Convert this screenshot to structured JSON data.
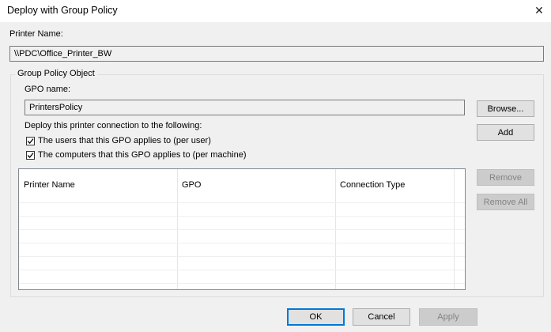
{
  "window": {
    "title": "Deploy with Group Policy",
    "close_glyph": "✕"
  },
  "printer": {
    "label": "Printer Name:",
    "value": "\\\\PDC\\Office_Printer_BW"
  },
  "group": {
    "title": "Group Policy Object",
    "gpo_label": "GPO name:",
    "gpo_value": "PrintersPolicy",
    "deploy_label": "Deploy this printer connection to the following:",
    "options": [
      {
        "label": "The users that this GPO applies to (per user)",
        "checked": true
      },
      {
        "label": "The computers that this GPO applies to (per machine)",
        "checked": true
      }
    ],
    "buttons": {
      "browse": "Browse...",
      "add": "Add",
      "remove": "Remove",
      "remove_all": "Remove All"
    },
    "table": {
      "columns": [
        "Printer Name",
        "GPO",
        "Connection Type"
      ],
      "rows": []
    }
  },
  "footer": {
    "ok": "OK",
    "cancel": "Cancel",
    "apply": "Apply"
  },
  "colors": {
    "accent": "#0078d7",
    "background": "#f0f0f0",
    "disabled_text": "#838383"
  }
}
